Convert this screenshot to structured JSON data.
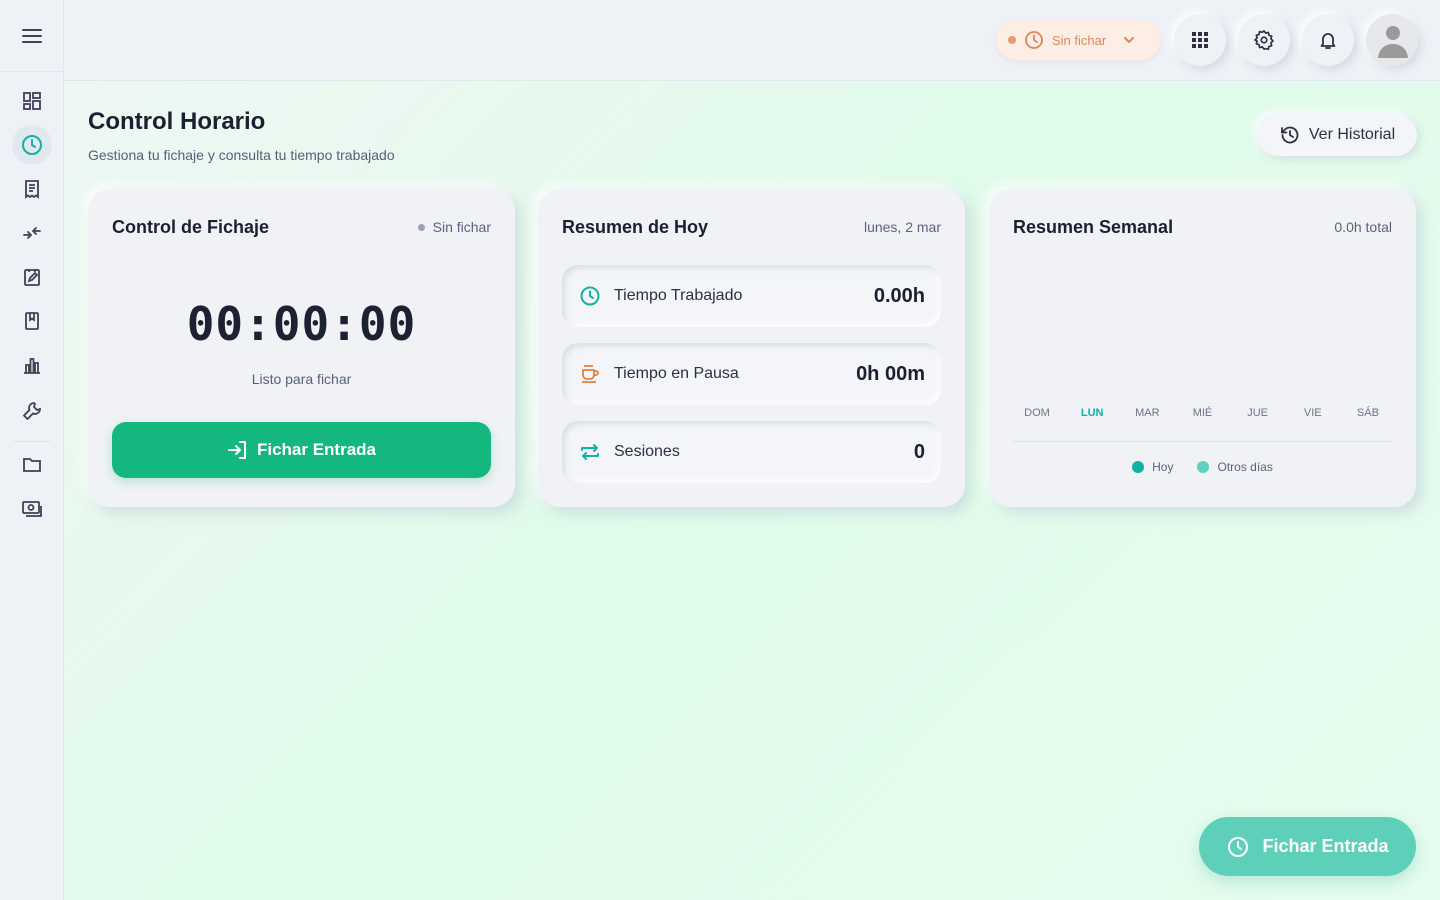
{
  "topbar": {
    "status_label": "Sin fichar"
  },
  "page": {
    "title": "Control Horario",
    "subtitle": "Gestiona tu fichaje y consulta tu tiempo trabajado",
    "history_button": "Ver Historial"
  },
  "clock_card": {
    "title": "Control de Fichaje",
    "status": "Sin fichar",
    "timer": "00:00:00",
    "timer_label": "Listo para fichar",
    "button_label": "Fichar Entrada"
  },
  "today_card": {
    "title": "Resumen de Hoy",
    "date": "lunes, 2 mar",
    "rows": [
      {
        "label": "Tiempo Trabajado",
        "value": "0.00h",
        "icon": "clock-icon"
      },
      {
        "label": "Tiempo en Pausa",
        "value": "0h 00m",
        "icon": "coffee-icon"
      },
      {
        "label": "Sesiones",
        "value": "0",
        "icon": "repeat-icon"
      }
    ]
  },
  "week_card": {
    "title": "Resumen Semanal",
    "total": "0.0h total",
    "days": [
      "DOM",
      "LUN",
      "MAR",
      "MIÉ",
      "JUE",
      "VIE",
      "SÁB"
    ],
    "today_index": 1,
    "legend": [
      {
        "label": "Hoy",
        "color": "#13b2a0"
      },
      {
        "label": "Otros días",
        "color": "#5ecfc0"
      }
    ]
  },
  "fab": {
    "label": "Fichar Entrada"
  },
  "colors": {
    "accent": "#14b87e",
    "teal": "#13b2a0",
    "status_orange": "#d9895b"
  }
}
